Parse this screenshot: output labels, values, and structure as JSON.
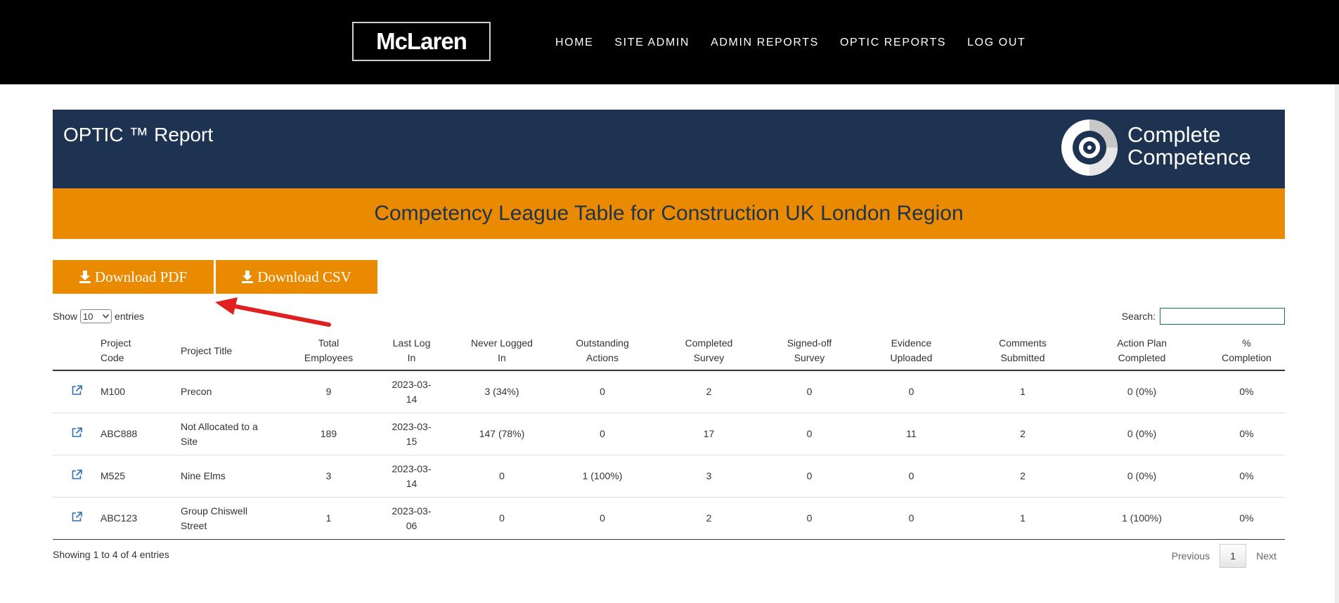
{
  "nav": {
    "logo": "McLaren",
    "links": [
      "HOME",
      "SITE ADMIN",
      "ADMIN REPORTS",
      "OPTIC REPORTS",
      "LOG OUT"
    ]
  },
  "report": {
    "title": "OPTIC ™ Report",
    "partner_logo": {
      "line1": "Complete",
      "line2": "Competence",
      "icon": "target-icon"
    },
    "banner": "Competency League Table for Construction UK London Region"
  },
  "actions": {
    "download_pdf": "Download PDF",
    "download_csv": "Download CSV"
  },
  "length": {
    "show": "Show",
    "value": "10",
    "entries": "entries"
  },
  "search": {
    "label": "Search:",
    "value": ""
  },
  "table": {
    "columns": [
      {
        "line1": "",
        "line2": ""
      },
      {
        "line1": "Project",
        "line2": "Code"
      },
      {
        "line1": "Project Title",
        "line2": ""
      },
      {
        "line1": "Total",
        "line2": "Employees"
      },
      {
        "line1": "Last Log",
        "line2": "In"
      },
      {
        "line1": "Never Logged",
        "line2": "In"
      },
      {
        "line1": "Outstanding",
        "line2": "Actions"
      },
      {
        "line1": "Completed",
        "line2": "Survey"
      },
      {
        "line1": "Signed-off",
        "line2": "Survey"
      },
      {
        "line1": "Evidence",
        "line2": "Uploaded"
      },
      {
        "line1": "Comments",
        "line2": "Submitted"
      },
      {
        "line1": "Action Plan",
        "line2": "Completed"
      },
      {
        "line1": "%",
        "line2": "Completion"
      }
    ],
    "rows": [
      {
        "code": "M100",
        "title1": "Precon",
        "title2": "",
        "total": "9",
        "last1": "2023-03-",
        "last2": "14",
        "never": "3 (34%)",
        "outstanding": "0",
        "completed": "2",
        "signed": "0",
        "evidence": "0",
        "comments": "1",
        "plan": "0 (0%)",
        "pct": "0%"
      },
      {
        "code": "ABC888",
        "title1": "Not Allocated to a",
        "title2": "Site",
        "total": "189",
        "last1": "2023-03-",
        "last2": "15",
        "never": "147 (78%)",
        "outstanding": "0",
        "completed": "17",
        "signed": "0",
        "evidence": "11",
        "comments": "2",
        "plan": "0 (0%)",
        "pct": "0%"
      },
      {
        "code": "M525",
        "title1": "Nine Elms",
        "title2": "",
        "total": "3",
        "last1": "2023-03-",
        "last2": "14",
        "never": "0",
        "outstanding": "1 (100%)",
        "completed": "3",
        "signed": "0",
        "evidence": "0",
        "comments": "2",
        "plan": "0 (0%)",
        "pct": "0%"
      },
      {
        "code": "ABC123",
        "title1": "Group Chiswell",
        "title2": "Street",
        "total": "1",
        "last1": "2023-03-",
        "last2": "06",
        "never": "0",
        "outstanding": "0",
        "completed": "2",
        "signed": "0",
        "evidence": "0",
        "comments": "1",
        "plan": "1 (100%)",
        "pct": "0%"
      }
    ]
  },
  "footer": {
    "info": "Showing 1 to 4 of 4 entries",
    "previous": "Previous",
    "page": "1",
    "next": "Next"
  },
  "colors": {
    "navy": "#1e3351",
    "orange": "#ea8a00",
    "link": "#2a6fb8",
    "annotation": "#e02020"
  }
}
